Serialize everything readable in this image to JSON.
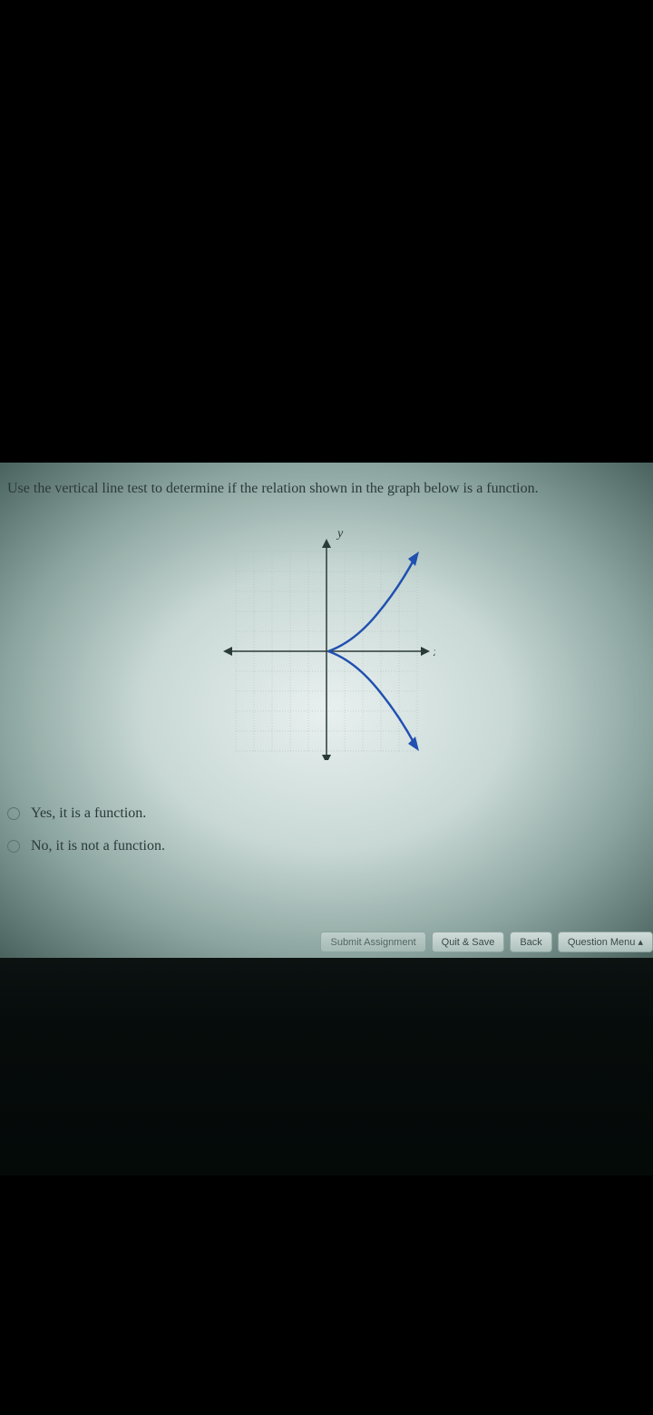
{
  "question": {
    "prompt": "Use the vertical line test to determine if the relation shown in the graph below is a function."
  },
  "graph": {
    "y_label": "y",
    "x_label": "x"
  },
  "options": [
    {
      "label": "Yes, it is a function."
    },
    {
      "label": "No, it is not a function."
    }
  ],
  "buttons": {
    "submit": "Submit Assignment",
    "quit": "Quit & Save",
    "back": "Back",
    "menu": "Question Menu ▴"
  }
}
